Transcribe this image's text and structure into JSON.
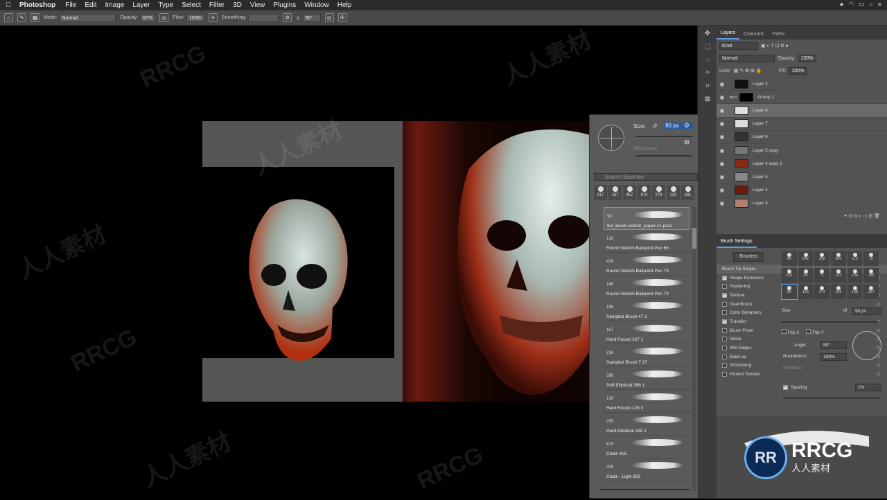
{
  "menubar": {
    "app": "Photoshop",
    "items": [
      "File",
      "Edit",
      "Image",
      "Layer",
      "Type",
      "Select",
      "Filter",
      "3D",
      "View",
      "Plugins",
      "Window",
      "Help"
    ]
  },
  "options": {
    "mode_label": "Mode:",
    "mode_value": "Normal",
    "opacity_label": "Opacity:",
    "opacity_value": "87%",
    "flow_label": "Flow:",
    "flow_value": "100%",
    "smoothing_label": "Smoothing:",
    "angle_value": "90°"
  },
  "brush_popup": {
    "size_label": "Size:",
    "size_value": "90 px",
    "hardness_label": "Hardness:",
    "search_placeholder": "Search Brushes",
    "presets": [
      "317",
      "167",
      "457",
      "870",
      "279",
      "130",
      "381"
    ],
    "brushes": [
      {
        "num": "90",
        "name": "flat_brush-sketch_paper-v1.psd1"
      },
      {
        "num": "128",
        "name": "Round Sketch Ballpoint Pen 65"
      },
      {
        "num": "474",
        "name": "Round Sketch Ballpoint Pen 75"
      },
      {
        "num": "186",
        "name": "Round Sketch Ballpoint Pen 74"
      },
      {
        "num": "198",
        "name": "Sampled Brush 47 2"
      },
      {
        "num": "167",
        "name": "Hard Round 167 1"
      },
      {
        "num": "216",
        "name": "Sampled Brush 7 27"
      },
      {
        "num": "396",
        "name": "Soft Elliptical 396 1"
      },
      {
        "num": "128",
        "name": "Hard Round 128 3"
      },
      {
        "num": "255",
        "name": "Hard Elliptical 255 1"
      },
      {
        "num": "679",
        "name": "Chalk 415"
      },
      {
        "num": "408",
        "name": "Chalk - Light 693"
      }
    ]
  },
  "layers_panel": {
    "tabs": [
      "Layers",
      "Channels",
      "Paths"
    ],
    "kind": "Kind",
    "blend": "Normal",
    "opacity_label": "Opacity:",
    "opacity_value": "100%",
    "lock_label": "Lock:",
    "fill_label": "Fill:",
    "fill_value": "100%",
    "layers": [
      "Layer 2",
      "Group 1",
      "Layer 8",
      "Layer 7",
      "Layer 6",
      "Layer 5 copy",
      "Layer 4 copy 2",
      "Layer 5",
      "Layer 4",
      "Layer 3"
    ]
  },
  "brush_settings": {
    "title": "Brush Settings",
    "brushes_button": "Brushes",
    "tip_shape": "Brush Tip Shape",
    "options": [
      {
        "label": "Shape Dynamics",
        "on": true
      },
      {
        "label": "Scattering",
        "on": false
      },
      {
        "label": "Texture",
        "on": true
      },
      {
        "label": "Dual Brush",
        "on": false
      },
      {
        "label": "Color Dynamics",
        "on": false
      },
      {
        "label": "Transfer",
        "on": true
      },
      {
        "label": "Brush Pose",
        "on": false
      },
      {
        "label": "Noise",
        "on": false
      },
      {
        "label": "Wet Edges",
        "on": false
      },
      {
        "label": "Build-up",
        "on": false
      },
      {
        "label": "Smoothing",
        "on": false
      },
      {
        "label": "Protect Texture",
        "on": false
      }
    ],
    "tips": [
      "80",
      "842",
      "258",
      "366",
      "113",
      "10",
      "113",
      "50",
      "71",
      "193",
      "134",
      "185",
      "90",
      "128",
      "474",
      "186",
      "198",
      "167"
    ],
    "size_label": "Size",
    "size_value": "90 px",
    "flipx": "Flip X",
    "flipy": "Flip Y",
    "angle_label": "Angle:",
    "angle_value": "90°",
    "roundness_label": "Roundness:",
    "roundness_value": "100%",
    "hardness_label": "Hardness",
    "spacing_label": "Spacing",
    "spacing_value": "1%"
  },
  "watermark": {
    "text1": "RRCG",
    "text2": "人人素材"
  },
  "logo": {
    "mark": "RR",
    "title": "RRCG",
    "subtitle": "人人素材"
  }
}
